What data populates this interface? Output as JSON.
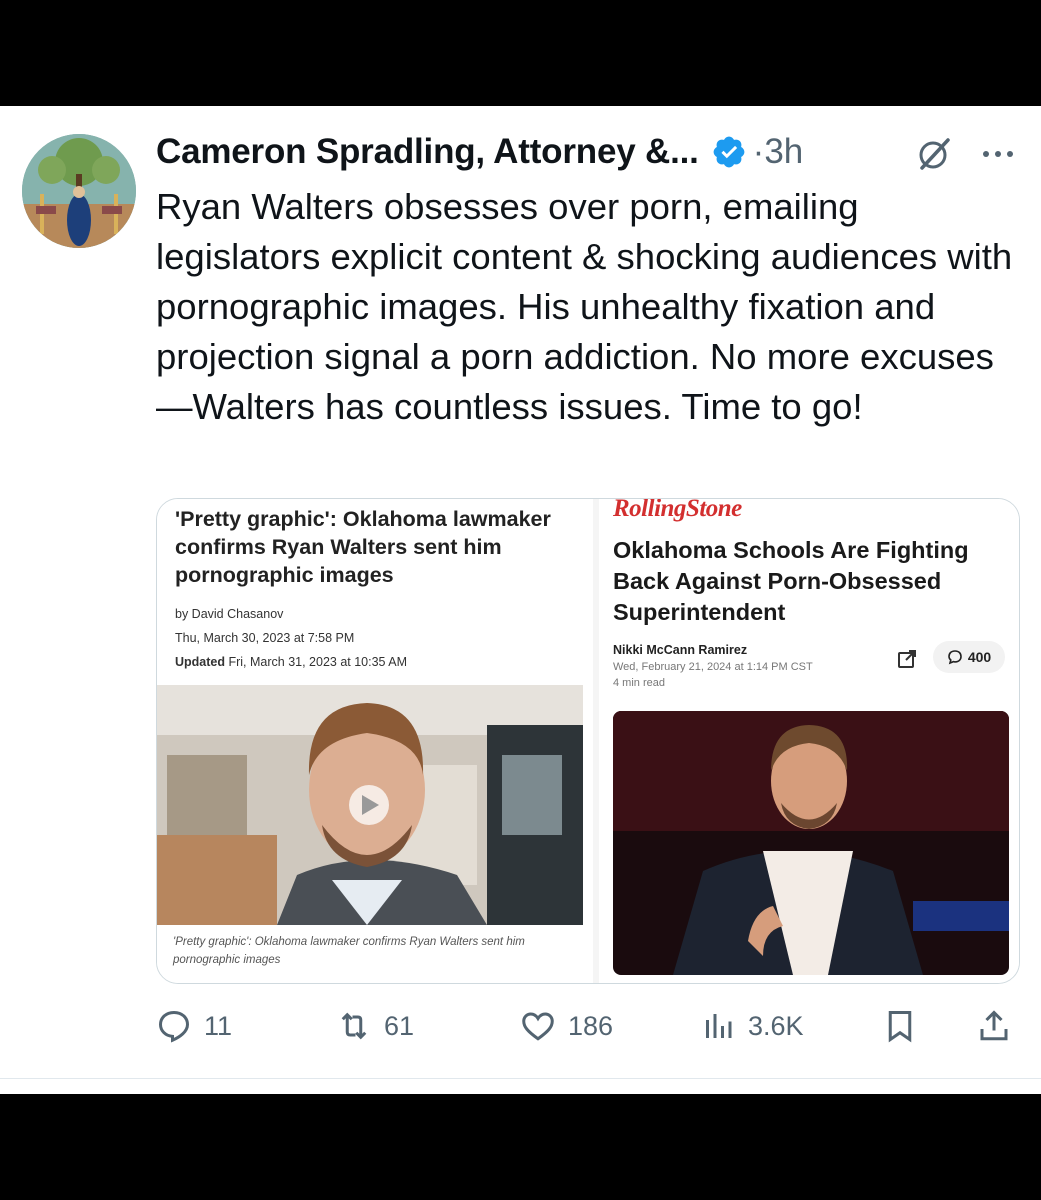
{
  "tweet": {
    "author_name": "Cameron Spradling, Attorney &...",
    "time": "3h",
    "time_separator": "·",
    "text": "Ryan Walters obsesses over porn, emailing legislators explicit content & shocking audiences with pornographic images. His unhealthy fixation and projection signal a porn addiction. No more excuses—Walters has countless issues. Time to go!",
    "accent_color": "#1d9bf0"
  },
  "left_article": {
    "headline": "'Pretty graphic': Oklahoma lawmaker confirms Ryan Walters sent him pornographic images",
    "byline": "by David Chasanov",
    "date": "Thu, March 30, 2023 at 7:58 PM",
    "updated_label": "Updated",
    "updated_date": " Fri, March 31, 2023 at 10:35 AM",
    "caption": "'Pretty graphic': Oklahoma lawmaker confirms Ryan Walters sent him pornographic images"
  },
  "right_article": {
    "publication": "RollingStone",
    "headline": "Oklahoma Schools Are Fighting Back Against Porn-Obsessed Superintendent",
    "author": "Nikki McCann Ramirez",
    "date": "Wed, February 21, 2024 at 1:14 PM CST",
    "read_time": "4 min read",
    "comment_count": "400",
    "brand_color": "#d32f2f"
  },
  "actions": {
    "replies": "11",
    "reposts": "61",
    "likes": "186",
    "views": "3.6K"
  }
}
